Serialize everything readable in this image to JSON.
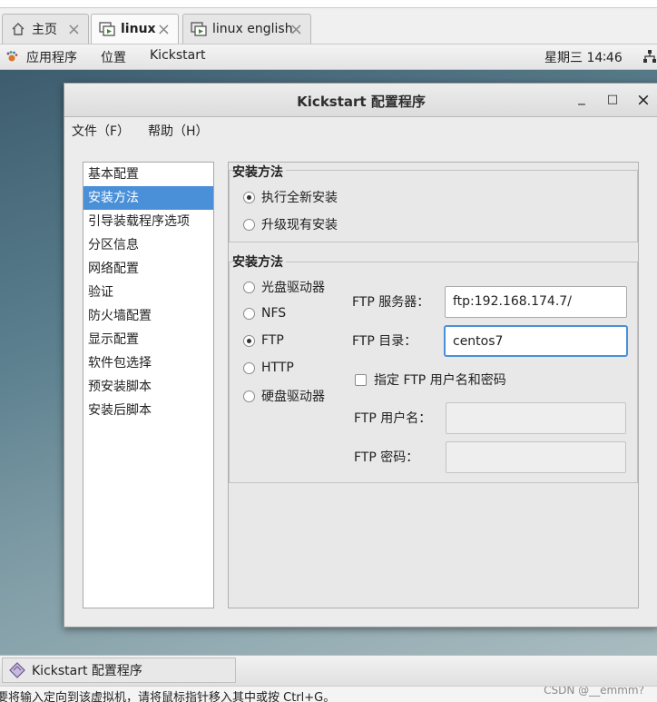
{
  "vm_tabs": [
    {
      "label": "主页",
      "icon": "home-icon",
      "active": false
    },
    {
      "label": "linux",
      "icon": "vm-icon",
      "active": true
    },
    {
      "label": "linux english",
      "icon": "vm-icon",
      "active": false
    }
  ],
  "tab_close_glyph": "×",
  "panel": {
    "applications": "应用程序",
    "places": "位置",
    "app_name": "Kickstart",
    "clock": "星期三 14∶46"
  },
  "window": {
    "title": "Kickstart 配置程序",
    "minimize": "_",
    "maximize": "□",
    "close": "×"
  },
  "menubar": {
    "file": "文件（F）",
    "help": "帮助（H）"
  },
  "nav": {
    "items": [
      "基本配置",
      "安装方法",
      "引导装载程序选项",
      "分区信息",
      "网络配置",
      "验证",
      "防火墙配置",
      "显示配置",
      "软件包选择",
      "预安装脚本",
      "安装后脚本"
    ],
    "selected_index": 1
  },
  "install_type": {
    "title": "安装方法",
    "options": [
      "执行全新安装",
      "升级现有安装"
    ],
    "selected_index": 0
  },
  "install_source": {
    "title": "安装方法",
    "options": [
      "光盘驱动器",
      "NFS",
      "FTP",
      "HTTP",
      "硬盘驱动器"
    ],
    "selected_index": 2
  },
  "ftp": {
    "server_label": "FTP 服务器：",
    "server_value": "ftp:192.168.174.7/",
    "dir_label": "FTP 目录：",
    "dir_value": "centos7",
    "auth_checkbox_label": "指定  FTP 用户名和密码",
    "auth_checked": false,
    "user_label": "FTP 用户名：",
    "user_value": "",
    "pass_label": "FTP 密码：",
    "pass_value": ""
  },
  "taskbar": {
    "task_label": "Kickstart 配置程序"
  },
  "statusbar": {
    "message": "要将输入定向到该虚拟机，请将鼠标指针移入其中或按 Ctrl+G。",
    "watermark": "CSDN @__emmm?"
  },
  "colors": {
    "selection": "#4a90d9",
    "focus": "#4a90d9"
  }
}
